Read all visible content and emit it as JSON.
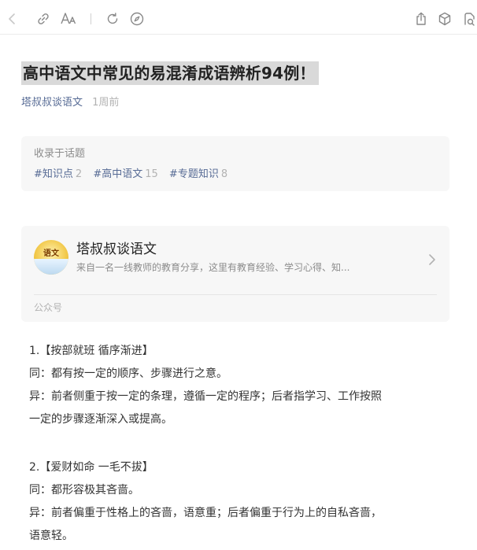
{
  "toolbar": {
    "icons": [
      "back-icon",
      "link-icon",
      "font-size-icon",
      "refresh-icon",
      "compass-icon",
      "share-icon",
      "cube-icon",
      "more-icon"
    ]
  },
  "article": {
    "title": "高中语文中常见的易混淆成语辨析94例！",
    "author": "塔叔叔谈语文",
    "time": "1周前"
  },
  "topics": {
    "label": "收录于话题",
    "tags": [
      {
        "name": "#知识点",
        "count": "2"
      },
      {
        "name": "#高中语文",
        "count": "15"
      },
      {
        "name": "#专题知识",
        "count": "8"
      }
    ]
  },
  "account": {
    "name": "塔叔叔谈语文",
    "description": "来自一名一线教师的教育分享，这里有教育经验、学习心得、知...",
    "type": "公众号",
    "avatar_text": "语文"
  },
  "content": {
    "item1_title": "1.【按部就班 循序渐进】",
    "item1_same": "同：都有按一定的顺序、步骤进行之意。",
    "item1_diff_a": "异：前者侧重于按一定的条理，遵循一定的程序；后者指学习、工作按照",
    "item1_diff_b": "一定的步骤逐渐深入或提高。",
    "item2_title": "2.【爱财如命 一毛不拔】",
    "item2_same": "同：都形容极其吝啬。",
    "item2_diff_a": "异：前者偏重于性格上的吝啬，语意重；后者偏重于行为上的自私吝啬，",
    "item2_diff_b": "语意轻。"
  },
  "colors": {
    "link": "#576b95",
    "muted": "#b2b2b2",
    "card_bg": "#f7f7f7",
    "title_highlight": "#d9d9d9"
  }
}
